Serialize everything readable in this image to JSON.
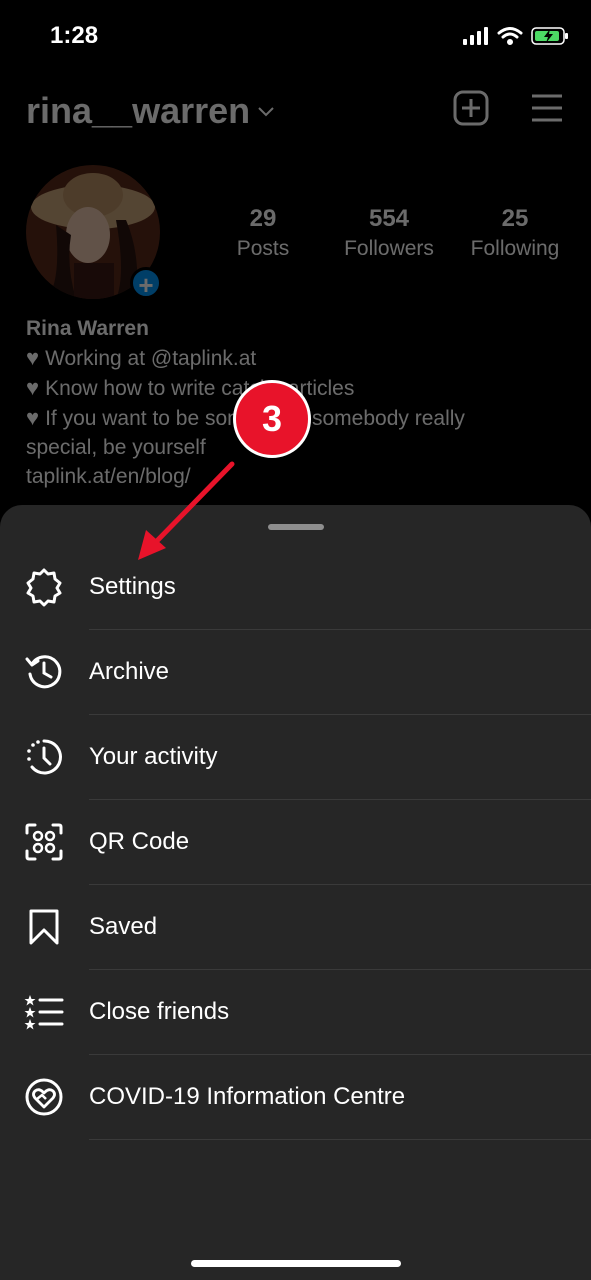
{
  "status_bar": {
    "time": "1:28"
  },
  "profile": {
    "username": "rina__warren",
    "stats": [
      {
        "value": "29",
        "label": "Posts"
      },
      {
        "value": "554",
        "label": "Followers"
      },
      {
        "value": "25",
        "label": "Following"
      }
    ],
    "bio": {
      "name": "Rina Warren",
      "line1": "Working at @taplink.at",
      "line2": "Know how to write catchy articles",
      "line3a": "If you want to be somebody, somebody really",
      "line3b": "special, be yourself",
      "link": "taplink.at/en/blog/"
    }
  },
  "menu": {
    "items": [
      {
        "label": "Settings",
        "icon": "settings-icon"
      },
      {
        "label": "Archive",
        "icon": "archive-icon"
      },
      {
        "label": "Your activity",
        "icon": "activity-icon"
      },
      {
        "label": "QR Code",
        "icon": "qr-code-icon"
      },
      {
        "label": "Saved",
        "icon": "bookmark-icon"
      },
      {
        "label": "Close friends",
        "icon": "close-friends-icon"
      },
      {
        "label": "COVID-19 Information Centre",
        "icon": "covid-info-icon"
      }
    ]
  },
  "annotation": {
    "step": "3",
    "color": "#e8132a"
  }
}
